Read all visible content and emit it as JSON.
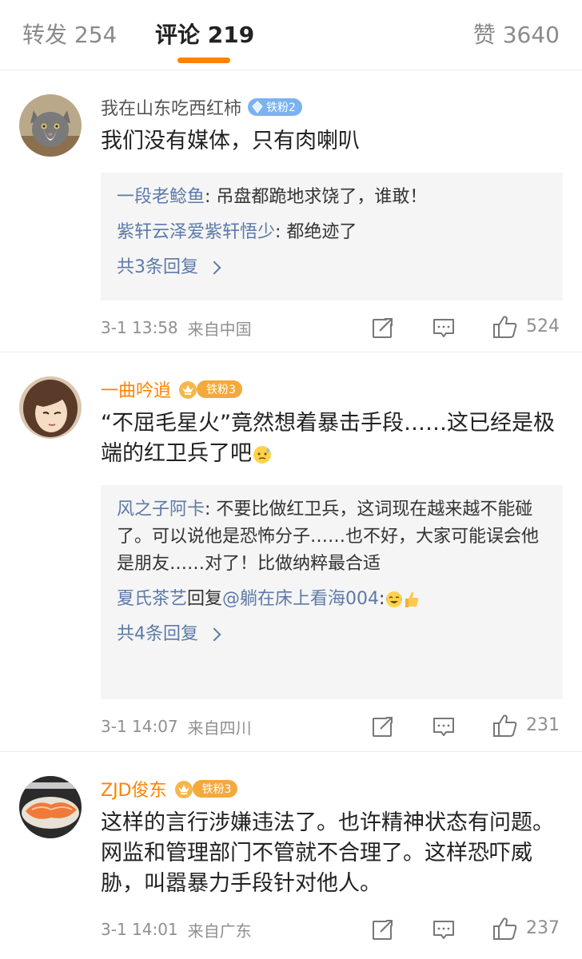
{
  "tabs": {
    "repost": "转发 254",
    "comments": "评论 219",
    "likes": "赞 3640"
  },
  "colors": {
    "accent": "#ff8200",
    "link": "#5d7aa8",
    "reply_bg": "#f5f5f5"
  },
  "comments": [
    {
      "user": "我在山东吃西红柿",
      "badge": "铁粉2",
      "avatar_icon": "cat-avatar-icon",
      "text": "我们没有媒体，只有肉喇叭",
      "replies": [
        {
          "user": "一段老鲶鱼",
          "text": ": 吊盘都跪地求饶了，谁敢！"
        },
        {
          "user": "紫轩云泽爱紫轩悟少",
          "text": ": 都绝迹了"
        }
      ],
      "more_replies": "共3条回复",
      "time": "3-1 13:58",
      "from": "来自中国",
      "likes": "524"
    },
    {
      "user": "一曲吟逍",
      "badge": "铁粉3",
      "avatar_icon": "cartoon-girl-avatar-icon",
      "text": "“不屈毛星火”竟然想着暴击手段……这已经是极端的红卫兵了吧",
      "text_emoji": "cold-sweat-emoji-icon",
      "replies": [
        {
          "user": "风之子阿卡",
          "text": ": 不要比做红卫兵，这词现在越来越不能碰了。可以说他是恐怖分子……也不好，大家可能误会他是朋友……对了！比做纳粹最合适"
        },
        {
          "user": "夏氏茶艺",
          "mid": "回复",
          "target": "@躺在床上看海004",
          "text": ":"
        }
      ],
      "more_replies": "共4条回复",
      "time": "3-1 14:07",
      "from": "来自四川",
      "likes": "231"
    },
    {
      "user": "ZJD俊东",
      "badge": "铁粉3",
      "avatar_icon": "salmon-food-avatar-icon",
      "text": "这样的言行涉嫌违法了。也许精神状态有问题。网监和管理部门不管就不合理了。这样恐吓威胁，叫嚣暴力手段针对他人。",
      "time": "3-1 14:01",
      "from": "来自广东",
      "likes": "237"
    }
  ]
}
